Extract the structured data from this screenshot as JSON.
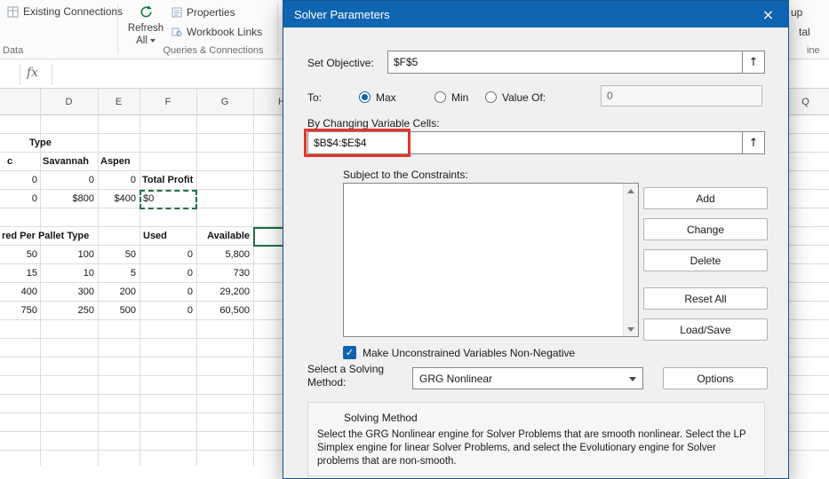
{
  "colors": {
    "title_bar": "#1065b3",
    "accent": "#0f63ac",
    "annotation_red": "#e3362c",
    "selection_green": "#1e7145",
    "refresh_green": "#107c41"
  },
  "ribbon": {
    "existing_connections": "Existing Connections",
    "data_group": "Data",
    "refresh_line1": "Refresh",
    "refresh_line2": "All",
    "properties": "Properties",
    "workbook_links": "Workbook Links",
    "queries_group": "Queries & Connections",
    "partial_group": "up",
    "partial_subtotal": "tal",
    "partial_outline": "ine"
  },
  "formula_bar": {
    "fx": "fx",
    "value": ""
  },
  "sheet": {
    "headers": {
      "d": "D",
      "e": "E",
      "f": "F",
      "g": "G",
      "h": "H",
      "q": "Q"
    },
    "rows": {
      "r1c": "Type",
      "r2c": "c",
      "r2d": "Savannah",
      "r2e": "Aspen",
      "r3c": "0",
      "r3d": "0",
      "r3e": "0",
      "r3f": "Total Profit",
      "r4c": "0",
      "r4d": "$800",
      "r4e": "$400",
      "r4f": "$0",
      "r6c": "red Per Pallet Type",
      "r6f": "Used",
      "r6g": "Available",
      "r7c": "50",
      "r7d": "100",
      "r7e": "50",
      "r7f": "0",
      "r7g": "5,800",
      "r8c": "15",
      "r8d": "10",
      "r8e": "5",
      "r8f": "0",
      "r8g": "730",
      "r9c": "400",
      "r9d": "300",
      "r9e": "200",
      "r9f": "0",
      "r9g": "29,200",
      "r10c": "750",
      "r10d": "250",
      "r10e": "500",
      "r10f": "0",
      "r10g": "60,500"
    }
  },
  "dialog": {
    "title": "Solver Parameters",
    "close_glyph": "×",
    "set_objective": "Set Objective:",
    "objective_value": "$F$5",
    "to": "To:",
    "max": "Max",
    "min": "Min",
    "value_of": "Value Of:",
    "value_of_value": "0",
    "by_changing": "By Changing Variable Cells:",
    "changing_value": "$B$4:$E$4",
    "constraints": "Subject to the Constraints:",
    "add": "Add",
    "change": "Change",
    "delete": "Delete",
    "reset_all": "Reset All",
    "load_save": "Load/Save",
    "non_negative": "Make Unconstrained Variables Non-Negative",
    "check_glyph": "✓",
    "select_method": "Select a Solving Method:",
    "method_value": "GRG Nonlinear",
    "options": "Options",
    "range_glyph": "↑",
    "solving_method_title": "Solving Method",
    "solving_method_desc": "Select the GRG Nonlinear engine for Solver Problems that are smooth nonlinear. Select the LP Simplex engine for linear Solver Problems, and select the Evolutionary engine for Solver problems that are non-smooth."
  }
}
